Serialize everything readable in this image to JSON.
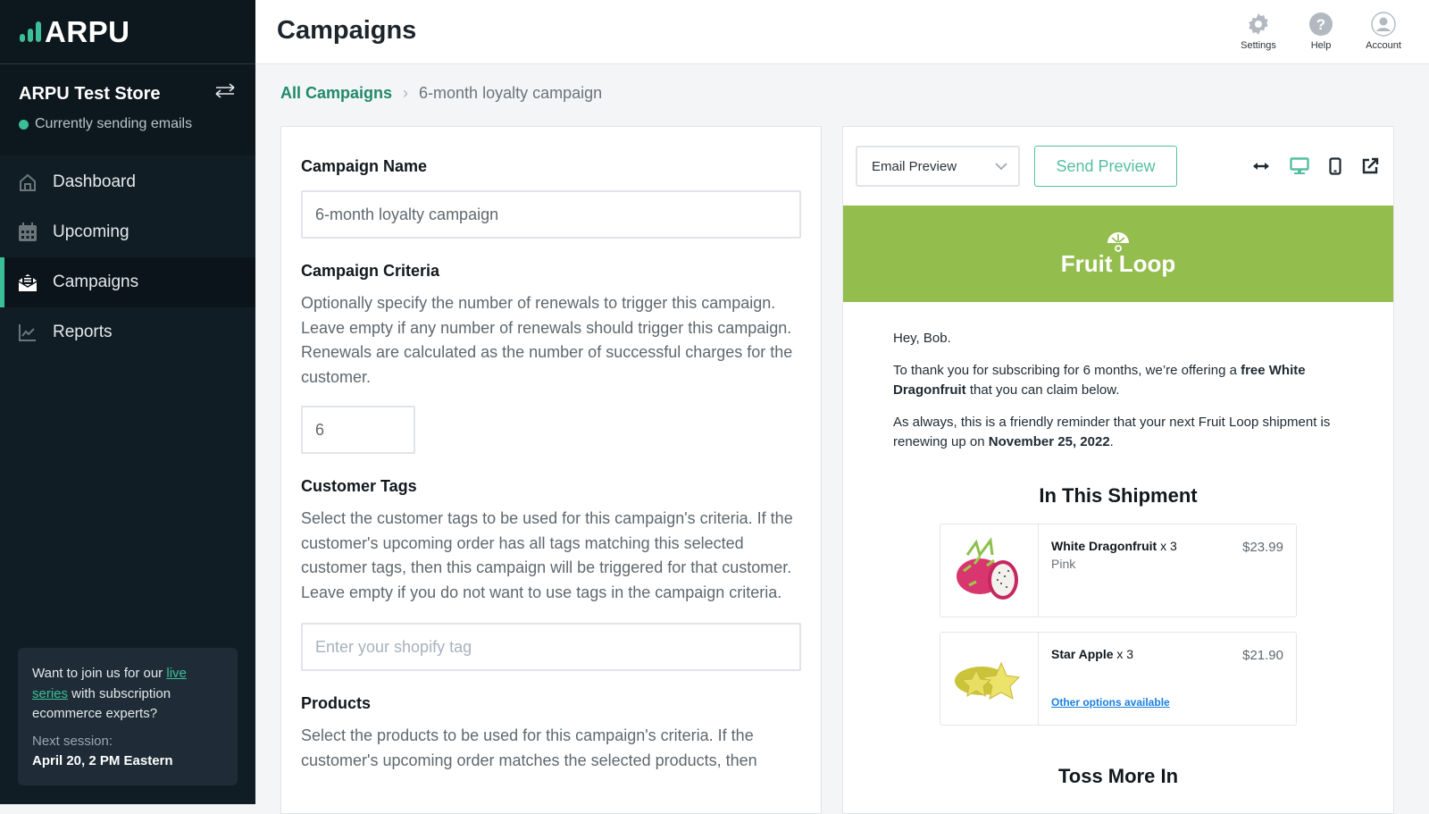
{
  "sidebar": {
    "logo_text": "ARPU",
    "store_name": "ARPU Test Store",
    "status_text": "Currently sending emails",
    "status_color": "#3bbf98",
    "items": [
      {
        "label": "Dashboard",
        "icon": "home-icon",
        "active": false
      },
      {
        "label": "Upcoming",
        "icon": "calendar-icon",
        "active": false
      },
      {
        "label": "Campaigns",
        "icon": "envelope-open-icon",
        "active": true
      },
      {
        "label": "Reports",
        "icon": "chart-line-icon",
        "active": false
      }
    ],
    "promo": {
      "text_before": "Want to join us for our ",
      "link_text": "live series",
      "text_after": " with subscription ecommerce experts?",
      "next_label": "Next session:",
      "next_date": "April 20, 2 PM Eastern"
    }
  },
  "header": {
    "title": "Campaigns",
    "icons": [
      {
        "label": "Settings",
        "icon": "gear-icon"
      },
      {
        "label": "Help",
        "icon": "help-icon"
      },
      {
        "label": "Account",
        "icon": "account-icon"
      }
    ]
  },
  "breadcrumb": {
    "root": "All Campaigns",
    "current": "6-month loyalty campaign"
  },
  "form": {
    "campaign_name": {
      "label": "Campaign Name",
      "value": "6-month loyalty campaign"
    },
    "criteria": {
      "label": "Campaign Criteria",
      "help": "Optionally specify the number of renewals to trigger this campaign. Leave empty if any number of renewals should trigger this campaign. Renewals are calculated as the number of successful charges for the customer.",
      "value": "6"
    },
    "tags": {
      "label": "Customer Tags",
      "help": "Select the customer tags to be used for this campaign's criteria. If the customer's upcoming order has all tags matching this selected customer tags, then this campaign will be triggered for that customer. Leave empty if you do not want to use tags in the campaign criteria.",
      "placeholder": "Enter your shopify tag"
    },
    "products": {
      "label": "Products",
      "help": "Select the products to be used for this campaign's criteria. If the customer's upcoming order matches the selected products, then"
    }
  },
  "preview": {
    "select_value": "Email Preview",
    "send_button": "Send Preview",
    "toolbar_icons": [
      "expand-horizontal-icon",
      "desktop-icon",
      "mobile-icon",
      "external-link-icon"
    ],
    "accent_color": "#55bfa0",
    "email": {
      "brand": "Fruit Loop",
      "banner_color": "#93bd4d",
      "greeting": "Hey, Bob.",
      "p1_before": "To thank you for subscribing for 6 months, we’re offering a ",
      "p1_bold": "free White Dragonfruit",
      "p1_after": " that you can claim below.",
      "p2_before": "As always, this is a friendly reminder that your next Fruit Loop shipment is renewing up on ",
      "p2_bold": "November 25, 2022",
      "p2_after": ".",
      "shipment_title": "In This Shipment",
      "products": [
        {
          "name": "White Dragonfruit",
          "qty": "x 3",
          "variant": "Pink",
          "price": "$23.99",
          "link": ""
        },
        {
          "name": "Star Apple",
          "qty": "x 3",
          "variant": "",
          "price": "$21.90",
          "link": "Other options available"
        }
      ],
      "toss_title": "Toss More In"
    }
  }
}
